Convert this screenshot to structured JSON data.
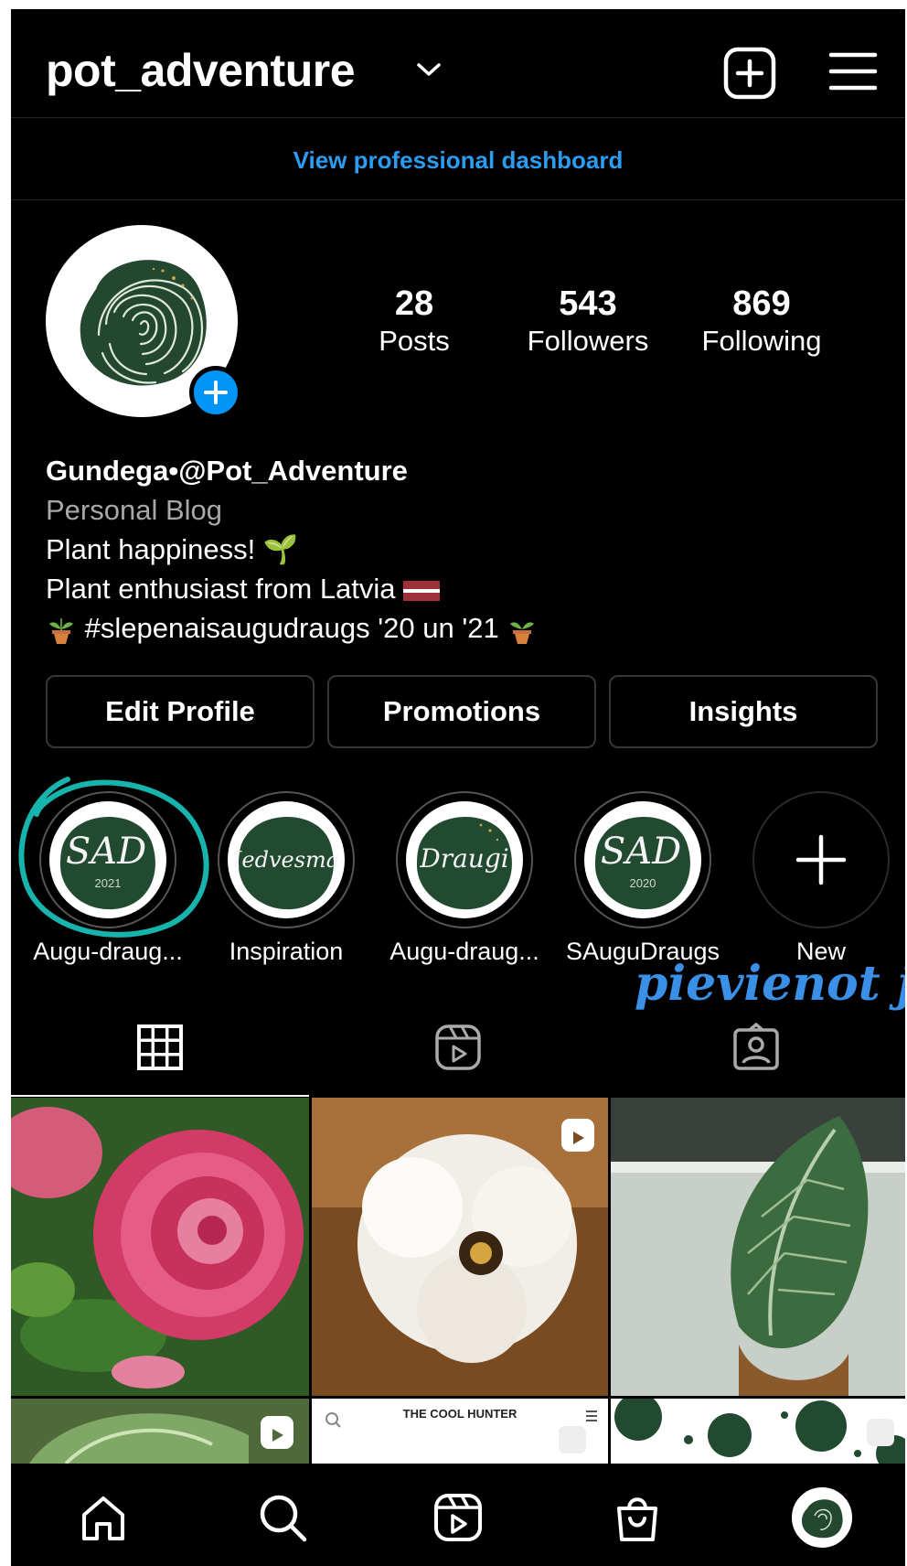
{
  "header": {
    "username": "pot_adventure",
    "professional_dashboard": "View professional dashboard"
  },
  "profile": {
    "stats": [
      {
        "value": "28",
        "label": "Posts"
      },
      {
        "value": "543",
        "label": "Followers"
      },
      {
        "value": "869",
        "label": "Following"
      }
    ],
    "name_line": "Gundega•@Pot_Adventure",
    "category": "Personal Blog",
    "bio": [
      "Plant happiness! 🌱",
      "Plant enthusiast from Latvia",
      "#slepenaisaugudraugs  '20 un '21"
    ]
  },
  "actions": {
    "edit_profile": "Edit Profile",
    "promotions": "Promotions",
    "insights": "Insights"
  },
  "highlights": [
    {
      "label": "Augu-draug...",
      "cover_text": "SAD",
      "cover_sub": "2021"
    },
    {
      "label": "Inspiration",
      "cover_text": "Iedvesma",
      "cover_sub": ""
    },
    {
      "label": "Augu-draug...",
      "cover_text": "Draugi",
      "cover_sub": ""
    },
    {
      "label": "SAuguDraugs",
      "cover_text": "SAD",
      "cover_sub": "2020"
    },
    {
      "label": "New",
      "cover_text": "",
      "cover_sub": ""
    }
  ],
  "annotation": {
    "handwritten_note": "pievienot ja",
    "accent_color": "#3a8fe6",
    "circle_color": "#17b3ad"
  },
  "grid_tabs": [
    "posts-grid",
    "reels",
    "tagged"
  ],
  "grid_previews": {
    "cool_hunter_title": "THE COOL HUNTER"
  },
  "colors": {
    "background": "#000000",
    "link_blue": "#2b9cf0",
    "plant_green": "#224a30"
  },
  "bottom_nav": [
    "home-icon",
    "search-icon",
    "reels-icon",
    "shop-icon",
    "profile-avatar"
  ]
}
